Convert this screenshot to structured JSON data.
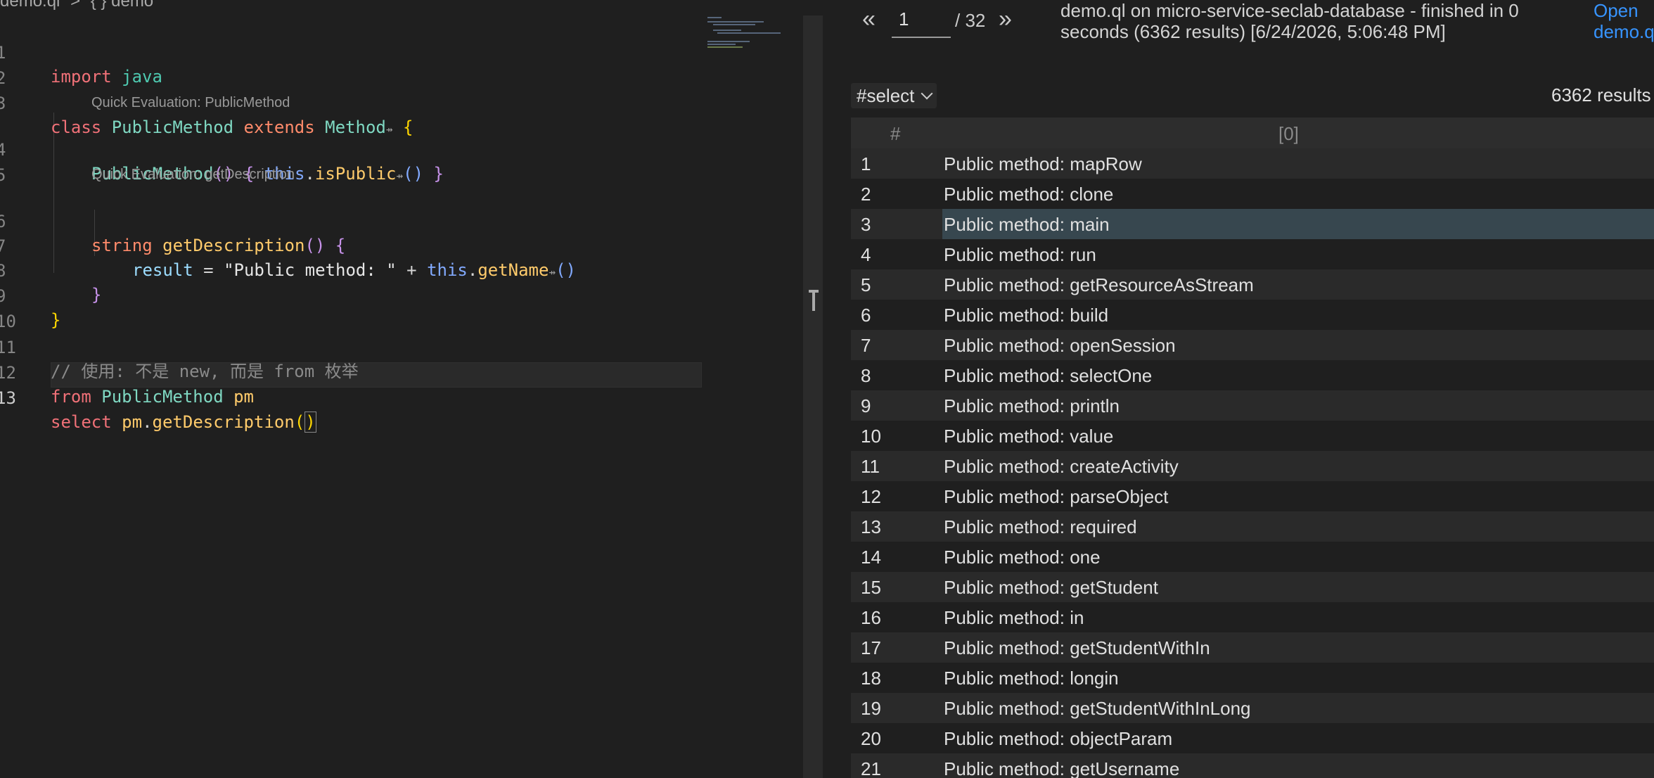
{
  "breadcrumb": {
    "file": "demo.ql",
    "sep": ">",
    "symbol": "{ } demo"
  },
  "editor": {
    "lens_1": "Quick Evaluation: PublicMethod",
    "lens_2": "Quick Evaluation: getDescription",
    "line_numbers": [
      "1",
      "2",
      "3",
      "4",
      "5",
      "6",
      "7",
      "8",
      "9",
      "10",
      "11",
      "12",
      "13"
    ],
    "tokens": {
      "import": "import",
      "java": "java",
      "class": "class",
      "PublicMethod": "PublicMethod",
      "extends": "extends",
      "Method": "Method",
      "ctor_name": "PublicMethod",
      "this": "this",
      "isPublic": "isPublic",
      "string": "string",
      "getDescription": "getDescription",
      "result": "result",
      "str": "\"Public method: \"",
      "getName": "getName",
      "comment": "// 使用: 不是 new, 而是 from 枚举",
      "from": "from",
      "pm_type": "PublicMethod",
      "pm": "pm",
      "select": "select",
      "pm2": "pm",
      "getDescription2": "getDescription"
    }
  },
  "results": {
    "prev": "«",
    "next": "»",
    "page": "1",
    "total_pages": "/ 32",
    "run_info": "demo.ql on micro-service-seclab-database - finished in 0 seconds (6362 results) [6/24/2026, 5:06:48 PM]",
    "open_link_line1": "Open",
    "open_link_line2": "demo.q",
    "result_set": "#select",
    "result_count": "6362 results",
    "columns": [
      "#",
      "[0]"
    ],
    "rows": [
      {
        "n": "1",
        "v": "Public method: mapRow"
      },
      {
        "n": "2",
        "v": "Public method: clone"
      },
      {
        "n": "3",
        "v": "Public method: main"
      },
      {
        "n": "4",
        "v": "Public method: run"
      },
      {
        "n": "5",
        "v": "Public method: getResourceAsStream"
      },
      {
        "n": "6",
        "v": "Public method: build"
      },
      {
        "n": "7",
        "v": "Public method: openSession"
      },
      {
        "n": "8",
        "v": "Public method: selectOne"
      },
      {
        "n": "9",
        "v": "Public method: println"
      },
      {
        "n": "10",
        "v": "Public method: value"
      },
      {
        "n": "11",
        "v": "Public method: createActivity"
      },
      {
        "n": "12",
        "v": "Public method: parseObject"
      },
      {
        "n": "13",
        "v": "Public method: required"
      },
      {
        "n": "14",
        "v": "Public method: one"
      },
      {
        "n": "15",
        "v": "Public method: getStudent"
      },
      {
        "n": "16",
        "v": "Public method: in"
      },
      {
        "n": "17",
        "v": "Public method: getStudentWithIn"
      },
      {
        "n": "18",
        "v": "Public method: longin"
      },
      {
        "n": "19",
        "v": "Public method: getStudentWithInLong"
      },
      {
        "n": "20",
        "v": "Public method: objectParam"
      },
      {
        "n": "21",
        "v": "Public method: getUsername"
      }
    ]
  },
  "colors": {
    "selected_row": "#37474f",
    "link": "#3794ff",
    "editor_bg": "#1f1f1f"
  }
}
